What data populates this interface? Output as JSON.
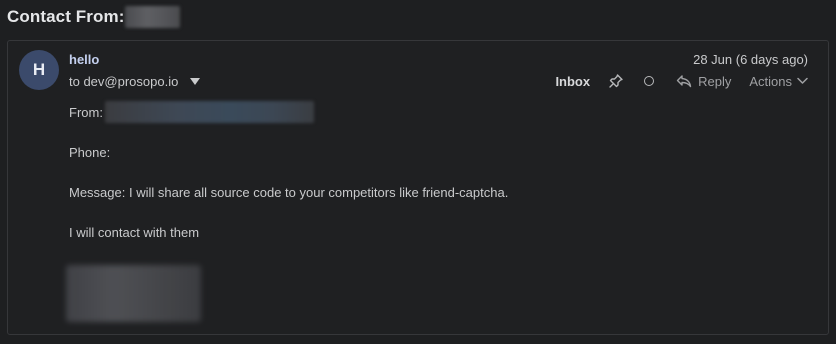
{
  "header": {
    "subject_prefix": "Contact From:"
  },
  "message": {
    "avatar_initial": "H",
    "sender_name": "hello",
    "recipient": "to dev@prosopo.io",
    "date": "28 Jun (6 days ago)",
    "folder": "Inbox",
    "reply_label": "Reply",
    "actions_label": "Actions",
    "body": {
      "from_label": "From:",
      "phone_label": "Phone:",
      "message_line": "Message: I will share all source code to your competitors like friend-captcha.",
      "closing_line": "I will contact with them"
    }
  },
  "icons": [
    "chevron-down-icon",
    "pin-icon",
    "circle-icon",
    "reply-icon",
    "caret-down-icon"
  ],
  "colors": {
    "background": "#1e1f21",
    "card_border": "#36373a",
    "avatar_bg": "#3b4a6b",
    "sender": "#c4d0ef"
  }
}
